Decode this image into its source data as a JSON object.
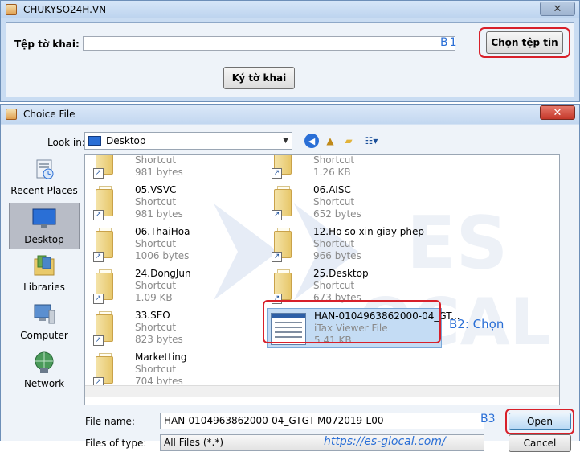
{
  "top_window": {
    "title": "CHUKYSO24H.VN",
    "close_label": "✕",
    "file_label": "Tệp tờ khai:",
    "file_value": "",
    "b1_note": "B1",
    "choose_button": "Chọn tệp tin",
    "sign_button": "Ký tờ khai"
  },
  "dialog": {
    "title": "Choice File",
    "close_label": "✕",
    "look_in_label": "Look in:",
    "look_in_value": "Desktop",
    "toolbar_icons": [
      "back-icon",
      "up-one-level-icon",
      "new-folder-icon",
      "view-menu-icon"
    ],
    "places": [
      {
        "label": "Recent Places",
        "icon": "recent-places-icon"
      },
      {
        "label": "Desktop",
        "icon": "desktop-icon",
        "active": true
      },
      {
        "label": "Libraries",
        "icon": "libraries-icon"
      },
      {
        "label": "Computer",
        "icon": "computer-icon"
      },
      {
        "label": "Network",
        "icon": "network-icon"
      }
    ],
    "files": [
      {
        "name": "",
        "type": "Shortcut",
        "size": "981 bytes"
      },
      {
        "name": "",
        "type": "Shortcut",
        "size": "1.26 KB"
      },
      {
        "name": "05.VSVC",
        "type": "Shortcut",
        "size": "981 bytes"
      },
      {
        "name": "06.AISC",
        "type": "Shortcut",
        "size": "652 bytes"
      },
      {
        "name": "06.ThaiHoa",
        "type": "Shortcut",
        "size": "1006 bytes"
      },
      {
        "name": "12.Ho so xin giay phep",
        "type": "Shortcut",
        "size": "966 bytes"
      },
      {
        "name": "24.DongJun",
        "type": "Shortcut",
        "size": "1.09 KB"
      },
      {
        "name": "25.Desktop",
        "type": "Shortcut",
        "size": "673 bytes"
      },
      {
        "name": "33.SEO",
        "type": "Shortcut",
        "size": "823 bytes"
      },
      {
        "name": "HAN-0104963862000-04_GT...",
        "type": "iTax Viewer File",
        "size": "5.41 KB",
        "selected": true
      },
      {
        "name": "Marketting",
        "type": "Shortcut",
        "size": "704 bytes"
      }
    ],
    "b2_note": "B2: Chọn",
    "file_name_label": "File name:",
    "file_name_value": "HAN-0104963862000-04_GTGT-M072019-L00",
    "files_of_type_label": "Files of type:",
    "files_of_type_value": "All Files (*.*)",
    "website": "https://es-glocal.com/",
    "b3_note": "B3",
    "open_button": "Open",
    "cancel_button": "Cancel"
  },
  "colors": {
    "annotation_red": "#d8202a",
    "annotation_blue": "#2a6fd6",
    "selection": "#c4dcf4"
  }
}
